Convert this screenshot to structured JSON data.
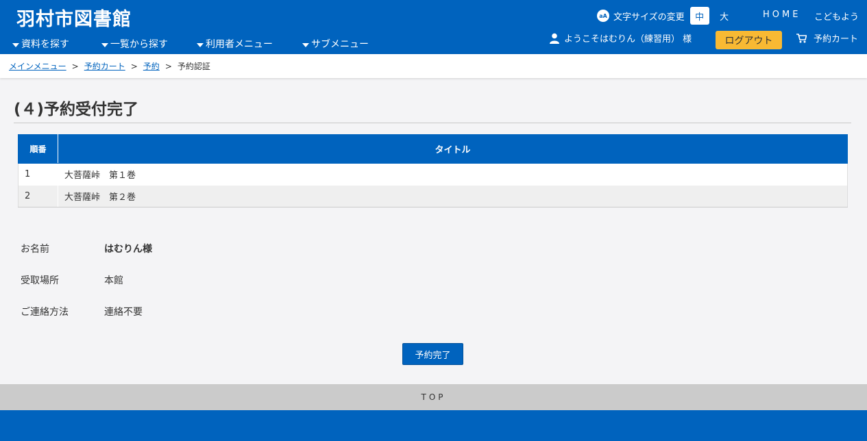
{
  "header": {
    "logo": "羽村市図書館",
    "font_size_label": "文字サイズの変更",
    "font_size_icon": "aA",
    "font_size_medium": "中",
    "font_size_large": "大",
    "home": "HOME",
    "kids": "こどもよう",
    "welcome": "ようこそはむりん（練習用） 様",
    "logout": "ログアウト",
    "cart": "予約カート",
    "brand_color": "#0063be",
    "logout_color": "#f8b933"
  },
  "nav": {
    "items": [
      {
        "label": "資料を探す"
      },
      {
        "label": "一覧から探す"
      },
      {
        "label": "利用者メニュー"
      },
      {
        "label": "サブメニュー"
      }
    ]
  },
  "breadcrumb": {
    "items": [
      {
        "label": "メインメニュー"
      },
      {
        "label": "予約カート"
      },
      {
        "label": "予約"
      }
    ],
    "separator": ">",
    "current": "予約認証"
  },
  "main": {
    "title": "(４)予約受付完了",
    "table": {
      "headers": [
        "順番",
        "タイトル"
      ],
      "rows": [
        {
          "num": "1",
          "title": "大菩薩峠　第１巻"
        },
        {
          "num": "2",
          "title": "大菩薩峠　第２巻"
        }
      ]
    },
    "info": [
      {
        "label": "お名前",
        "value": "はむりん様"
      },
      {
        "label": "受取場所",
        "value": "本館"
      },
      {
        "label": "ご連絡方法",
        "value": "連絡不要"
      }
    ],
    "complete_button": "予約完了"
  },
  "footer": {
    "top": "TOP"
  }
}
